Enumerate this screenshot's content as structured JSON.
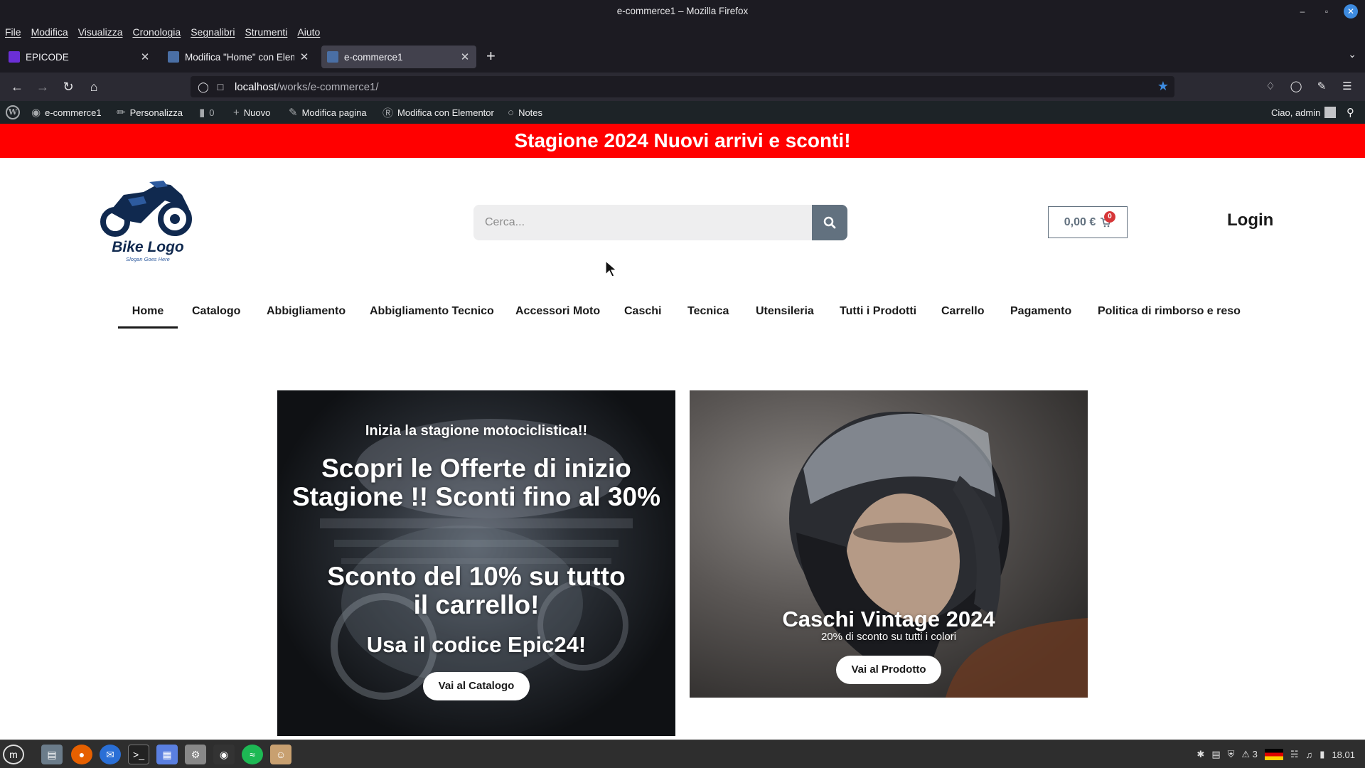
{
  "browser": {
    "window_title": "e-commerce1 – Mozilla Firefox",
    "menu": [
      "File",
      "Modifica",
      "Visualizza",
      "Cronologia",
      "Segnalibri",
      "Strumenti",
      "Aiuto"
    ],
    "tabs": [
      {
        "label": "EPICODE",
        "active": false
      },
      {
        "label": "Modifica \"Home\" con Elementor",
        "active": false
      },
      {
        "label": "e-commerce1",
        "active": true
      }
    ],
    "url_host": "localhost",
    "url_path": "/works/e-commerce1/"
  },
  "admin_bar": {
    "site_name": "e-commerce1",
    "customize": "Personalizza",
    "comments_count": "0",
    "new": "Nuovo",
    "edit_page": "Modifica pagina",
    "edit_elementor": "Modifica con Elementor",
    "notes": "Notes",
    "greeting": "Ciao, admin"
  },
  "site": {
    "promo_text": "Stagione 2024 Nuovi arrivi e sconti!",
    "logo_text": "Bike Logo",
    "logo_slogan": "Slogan Goes Here",
    "search_placeholder": "Cerca...",
    "cart_total": "0,00 €",
    "cart_count": "0",
    "login_label": "Login",
    "nav": [
      "Home",
      "Catalogo",
      "Abbigliamento",
      "Abbigliamento Tecnico",
      "Accessori Moto",
      "Caschi",
      "Tecnica",
      "Utensileria",
      "Tutti i Prodotti",
      "Carrello",
      "Pagamento",
      "Politica di rimborso e reso"
    ],
    "nav_active": "Home",
    "banner_left": {
      "kicker": "Inizia la stagione motociclistica!!",
      "headline": "Scopri le Offerte di inizio Stagione !! Sconti fino al 30%",
      "discount": "Sconto del 10% su tutto il carrello!",
      "code": "Usa il codice Epic24!",
      "button": "Vai al Catalogo"
    },
    "banner_right": {
      "title": "Caschi Vintage 2024",
      "subtitle": "20% di sconto su tutti i colori",
      "button": "Vai al Prodotto"
    }
  },
  "taskbar": {
    "clock": "18.01",
    "notif_count": "3"
  },
  "colors": {
    "promo_red": "#ff0000",
    "accent_gray": "#62717f",
    "firefox_blue": "#3d8be0",
    "logo_navy": "#10294f"
  }
}
